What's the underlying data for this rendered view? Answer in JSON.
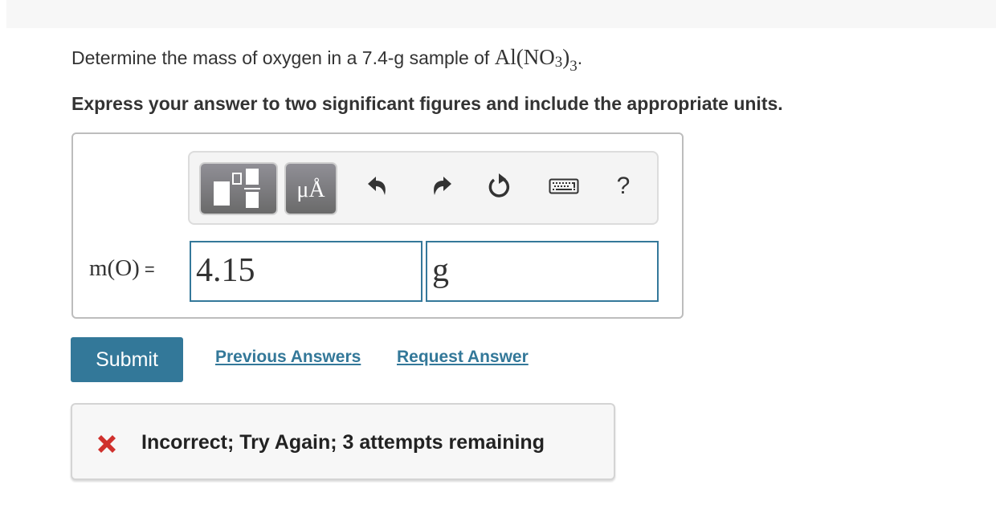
{
  "question": {
    "prompt_prefix": "Determine the mass of oxygen in a 7.4-g sample of ",
    "formula": {
      "base": "Al(NO",
      "inner_sub": "3",
      "close": ")",
      "outer_sub": "3"
    },
    "prompt_suffix": ".",
    "instruction": "Express your answer to two significant figures and include the appropriate units."
  },
  "toolbar": {
    "templates_label": "templates",
    "units_label": "μÅ",
    "undo_icon": "undo-icon",
    "redo_icon": "redo-icon",
    "reset_icon": "reset-icon",
    "keyboard_icon": "keyboard-icon",
    "help_label": "?"
  },
  "answer": {
    "label": "m(O)",
    "equals": "=",
    "value": "4.15",
    "unit": "g"
  },
  "actions": {
    "submit_label": "Submit",
    "previous_answers_label": "Previous Answers",
    "request_answer_label": "Request Answer"
  },
  "feedback": {
    "icon": "x-mark-icon",
    "message": "Incorrect; Try Again; 3 attempts remaining",
    "color": "#d0312d"
  },
  "colors": {
    "accent": "#337899"
  }
}
